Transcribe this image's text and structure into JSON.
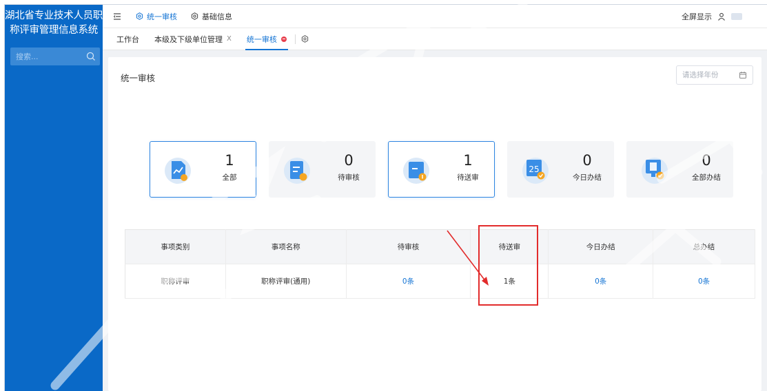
{
  "sidebar": {
    "brand_line1": "湖北省专业技术人员职",
    "brand_line2": "称评审管理信息系统",
    "search_placeholder": "搜索..."
  },
  "topbar": {
    "nav": [
      {
        "label": "统一审核",
        "icon": "settings-icon",
        "active": true
      },
      {
        "label": "基础信息",
        "icon": "settings-icon",
        "active": false
      }
    ],
    "fullscreen_label": "全屏显示"
  },
  "tabs": [
    {
      "label": "工作台",
      "closable": false
    },
    {
      "label": "本级及下级单位管理",
      "closable": true,
      "close": "X"
    },
    {
      "label": "统一审核",
      "active": true
    }
  ],
  "page": {
    "title": "统一审核",
    "year_placeholder": "请选择年份"
  },
  "stats": [
    {
      "value": "1",
      "label": "全部",
      "icon": "document-chart-icon",
      "active": true
    },
    {
      "value": "0",
      "label": "待审核",
      "icon": "document-user-icon",
      "active": false
    },
    {
      "value": "1",
      "label": "待送审",
      "icon": "folder-upload-icon",
      "active": true
    },
    {
      "value": "0",
      "label": "今日办结",
      "icon": "calendar-25-icon",
      "active": false
    },
    {
      "value": "0",
      "label": "全部办结",
      "icon": "monitor-check-icon",
      "active": false
    }
  ],
  "table": {
    "headers": [
      "事项类别",
      "事项名称",
      "待审核",
      "待送审",
      "今日办结",
      "总办结"
    ],
    "rows": [
      [
        "职称评审",
        "职称评审(通用)",
        "0条",
        "1条",
        "0条",
        "0条"
      ]
    ]
  },
  "colors": {
    "sidebar": "#0a69c7",
    "accent": "#1474d4",
    "highlight": "#e22b2b"
  }
}
